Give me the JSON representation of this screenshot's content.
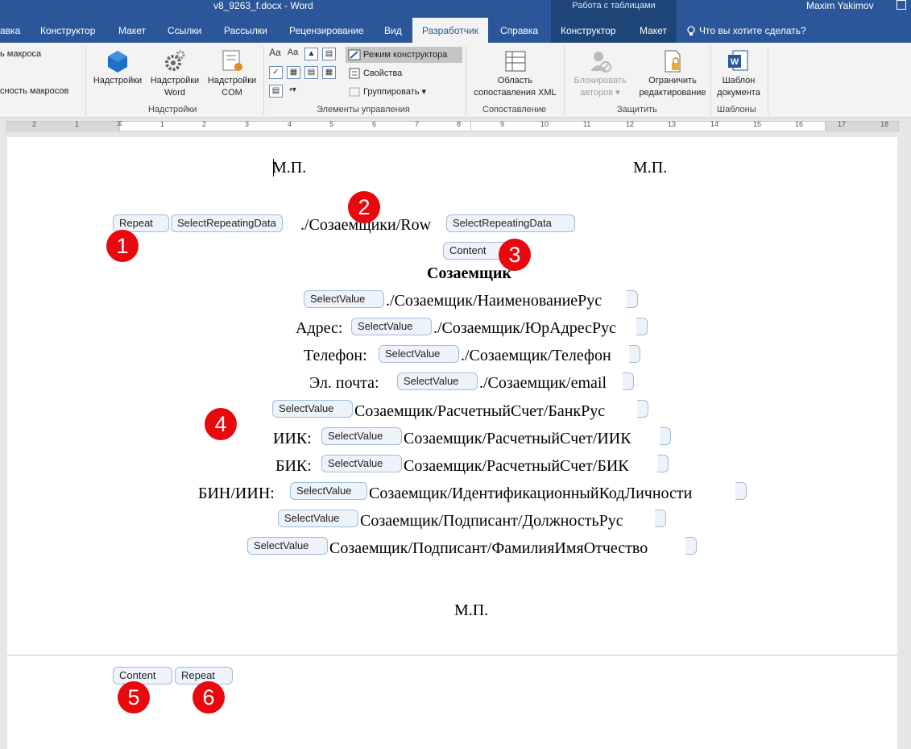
{
  "titlebar": {
    "doc_title": "v8_9263_f.docx  -  Word",
    "context_title": "Работа с таблицами",
    "user": "Maxim Yakimov"
  },
  "tabs": [
    {
      "label": "авка"
    },
    {
      "label": "Конструктор"
    },
    {
      "label": "Макет"
    },
    {
      "label": "Ссылки"
    },
    {
      "label": "Рассылки"
    },
    {
      "label": "Рецензирование"
    },
    {
      "label": "Вид"
    },
    {
      "label": "Разработчик"
    },
    {
      "label": "Справка"
    },
    {
      "label": "Конструктор"
    },
    {
      "label": "Макет"
    },
    {
      "label": "Что вы хотите сделать?"
    }
  ],
  "ribbon": {
    "macro_security_1": "ь макроса",
    "macro_security_2": "сность макросов",
    "addins": {
      "addins_label": "Надстройки",
      "word_addins_1": "Надстройки",
      "word_addins_2": "Word",
      "com_addins_1": "Надстройки",
      "com_addins_2": "COM",
      "group": "Надстройки"
    },
    "controls": {
      "design_mode": "Режим конструктора",
      "properties": "Свойства",
      "group_btn": "Группировать",
      "group": "Элементы управления"
    },
    "mapping": {
      "xml_pane_1": "Область",
      "xml_pane_2": "сопоставления XML",
      "group": "Сопоставление"
    },
    "protect": {
      "block_1": "Блокировать",
      "block_2": "авторов",
      "restrict_1": "Ограничить",
      "restrict_2": "редактирование",
      "group": "Защитить"
    },
    "templates": {
      "doc_template_1": "Шаблон",
      "doc_template_2": "документа",
      "group": "Шаблоны"
    }
  },
  "ruler_numbers": [
    "2",
    "1",
    "1",
    "2",
    "3",
    "4",
    "5",
    "6",
    "7",
    "8",
    "9",
    "10",
    "11",
    "12",
    "13",
    "14",
    "15",
    "16",
    "17",
    "18"
  ],
  "document": {
    "mp_left": "М.П.",
    "mp_right": "М.П.",
    "repeat_tag": "Repeat",
    "select_repeating_data": "SelectRepeatingData",
    "repeat_path": "./Созаемщики/Row",
    "content_tag": "Content",
    "heading": "Созаемщик",
    "select_value": "SelectValue",
    "lines": [
      {
        "label": "",
        "path": "./Созаемщик/НаименованиеРус"
      },
      {
        "label": "Адрес:",
        "path": "./Созаемщик/ЮрАдресРус"
      },
      {
        "label": "Телефон:",
        "path": "./Созаемщик/Телефон"
      },
      {
        "label": "Эл. почта:",
        "path": "./Созаемщик/email"
      },
      {
        "label": "",
        "path": "Созаемщик/РасчетныйСчет/БанкРус"
      },
      {
        "label": "ИИК:",
        "path": "Созаемщик/РасчетныйСчет/ИИК"
      },
      {
        "label": "БИК:",
        "path": "Созаемщик/РасчетныйСчет/БИК"
      },
      {
        "label": "БИН/ИИН:",
        "path": "Созаемщик/ИдентификационныйКодЛичности"
      },
      {
        "label": "",
        "path": "Созаемщик/Подписант/ДолжностьРус"
      },
      {
        "label": "",
        "path": "Созаемщик/Подписант/ФамилияИмяОтчество"
      }
    ],
    "mp_bottom": "М.П.",
    "content_end_tag": "Content",
    "repeat_end_tag": "Repeat"
  },
  "badges": [
    "1",
    "2",
    "3",
    "4",
    "5",
    "6"
  ],
  "colors": {
    "word_blue": "#2b579a",
    "badge_red": "#e8080e",
    "tag_border": "#9fbcdc"
  }
}
